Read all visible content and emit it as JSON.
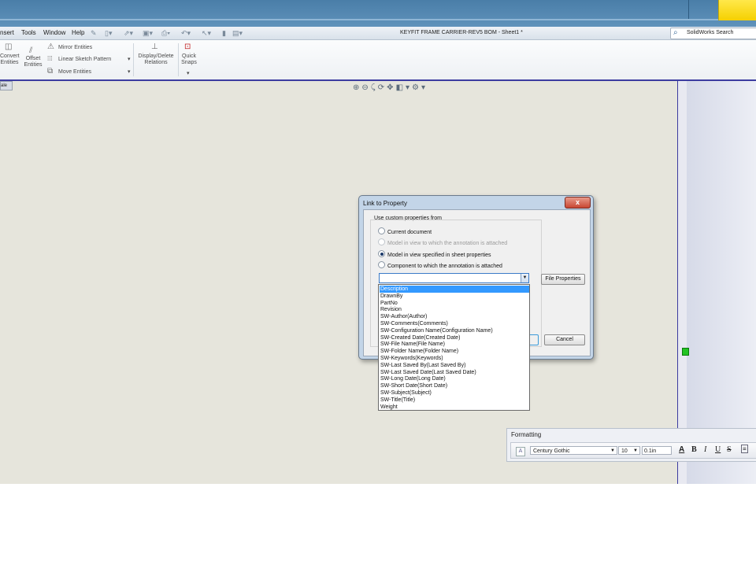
{
  "menubar": {
    "items": [
      "nsert",
      "Tools",
      "Window",
      "Help"
    ],
    "title": "KEYFIT FRAME CARRIER-REV5 BOM - Sheet1 *",
    "search_placeholder": "SolidWorks Search"
  },
  "ribbon": {
    "convert": "Convert\nEntities",
    "offset": "Offset\nEntities",
    "mirror": "Mirror Entities",
    "linear_pattern": "Linear Sketch Pattern",
    "move": "Move Entities",
    "display_delete": "Display/Delete\nRelations",
    "quick_snaps": "Quick\nSnaps"
  },
  "sheet_tab": "ale",
  "dialog": {
    "title": "Link to Property",
    "close": "x",
    "group_label": "Use custom properties from",
    "options": [
      {
        "label": "Current document",
        "state": "unchecked"
      },
      {
        "label": "Model in view to which the annotation is attached",
        "state": "disabled"
      },
      {
        "label": "Model in view specified in sheet properties",
        "state": "checked"
      },
      {
        "label": "Component to which the annotation is attached",
        "state": "unchecked"
      }
    ],
    "combo_value": "",
    "file_properties": "File Properties",
    "cancel": "Cancel"
  },
  "dropdown": {
    "selected_index": 0,
    "items": [
      "Description",
      "DrawnBy",
      "PartNo",
      "Revision",
      "SW-Author(Author)",
      "SW-Comments(Comments)",
      "SW-Configuration Name(Configuration Name)",
      "SW-Created Date(Created Date)",
      "SW-File Name(File Name)",
      "SW-Folder Name(Folder Name)",
      "SW-Keywords(Keywords)",
      "SW-Last Saved By(Last Saved By)",
      "SW-Last Saved Date(Last Saved Date)",
      "SW-Long Date(Long Date)",
      "SW-Short Date(Short Date)",
      "SW-Subject(Subject)",
      "SW-Title(Title)",
      "Weight"
    ]
  },
  "formatting": {
    "title": "Formatting",
    "font": "Century Gothic",
    "size": "10",
    "spacing": "0.1in",
    "buttons": [
      "A",
      "B",
      "I",
      "U",
      "S"
    ]
  },
  "colors": {
    "selection": "#3399ff",
    "canvas": "#e6e5dc",
    "dialog_frame": "#c3d5e8",
    "close_button": "#c84632"
  }
}
